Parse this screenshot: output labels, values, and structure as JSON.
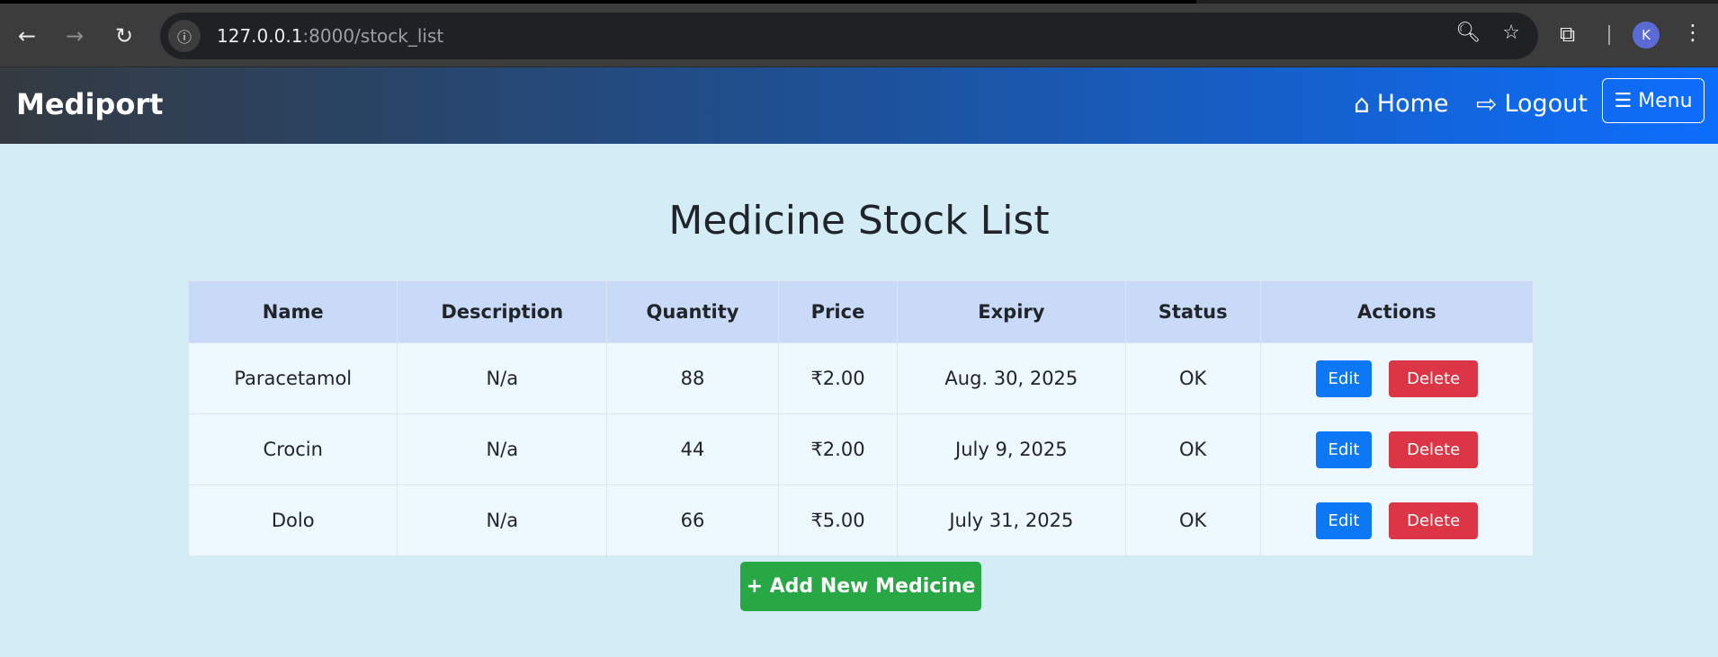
{
  "browser": {
    "url_host": "127.0.0.1",
    "url_rest": ":8000/stock_list",
    "avatar_letter": "K"
  },
  "navbar": {
    "brand": "Mediport",
    "home_label": "Home",
    "logout_label": "Logout",
    "menu_label": "☰ Menu"
  },
  "page": {
    "title": "Medicine Stock List",
    "add_button": "+ Add New Medicine"
  },
  "table": {
    "headers": [
      "Name",
      "Description",
      "Quantity",
      "Price",
      "Expiry",
      "Status",
      "Actions"
    ],
    "rows": [
      {
        "name": "Paracetamol",
        "description": "N/a",
        "quantity": "88",
        "price": "₹2.00",
        "expiry": "Aug. 30, 2025",
        "status": "OK"
      },
      {
        "name": "Crocin",
        "description": "N/a",
        "quantity": "44",
        "price": "₹2.00",
        "expiry": "July 9, 2025",
        "status": "OK"
      },
      {
        "name": "Dolo",
        "description": "N/a",
        "quantity": "66",
        "price": "₹5.00",
        "expiry": "July 31, 2025",
        "status": "OK"
      }
    ],
    "edit_label": "Edit",
    "delete_label": "Delete"
  }
}
